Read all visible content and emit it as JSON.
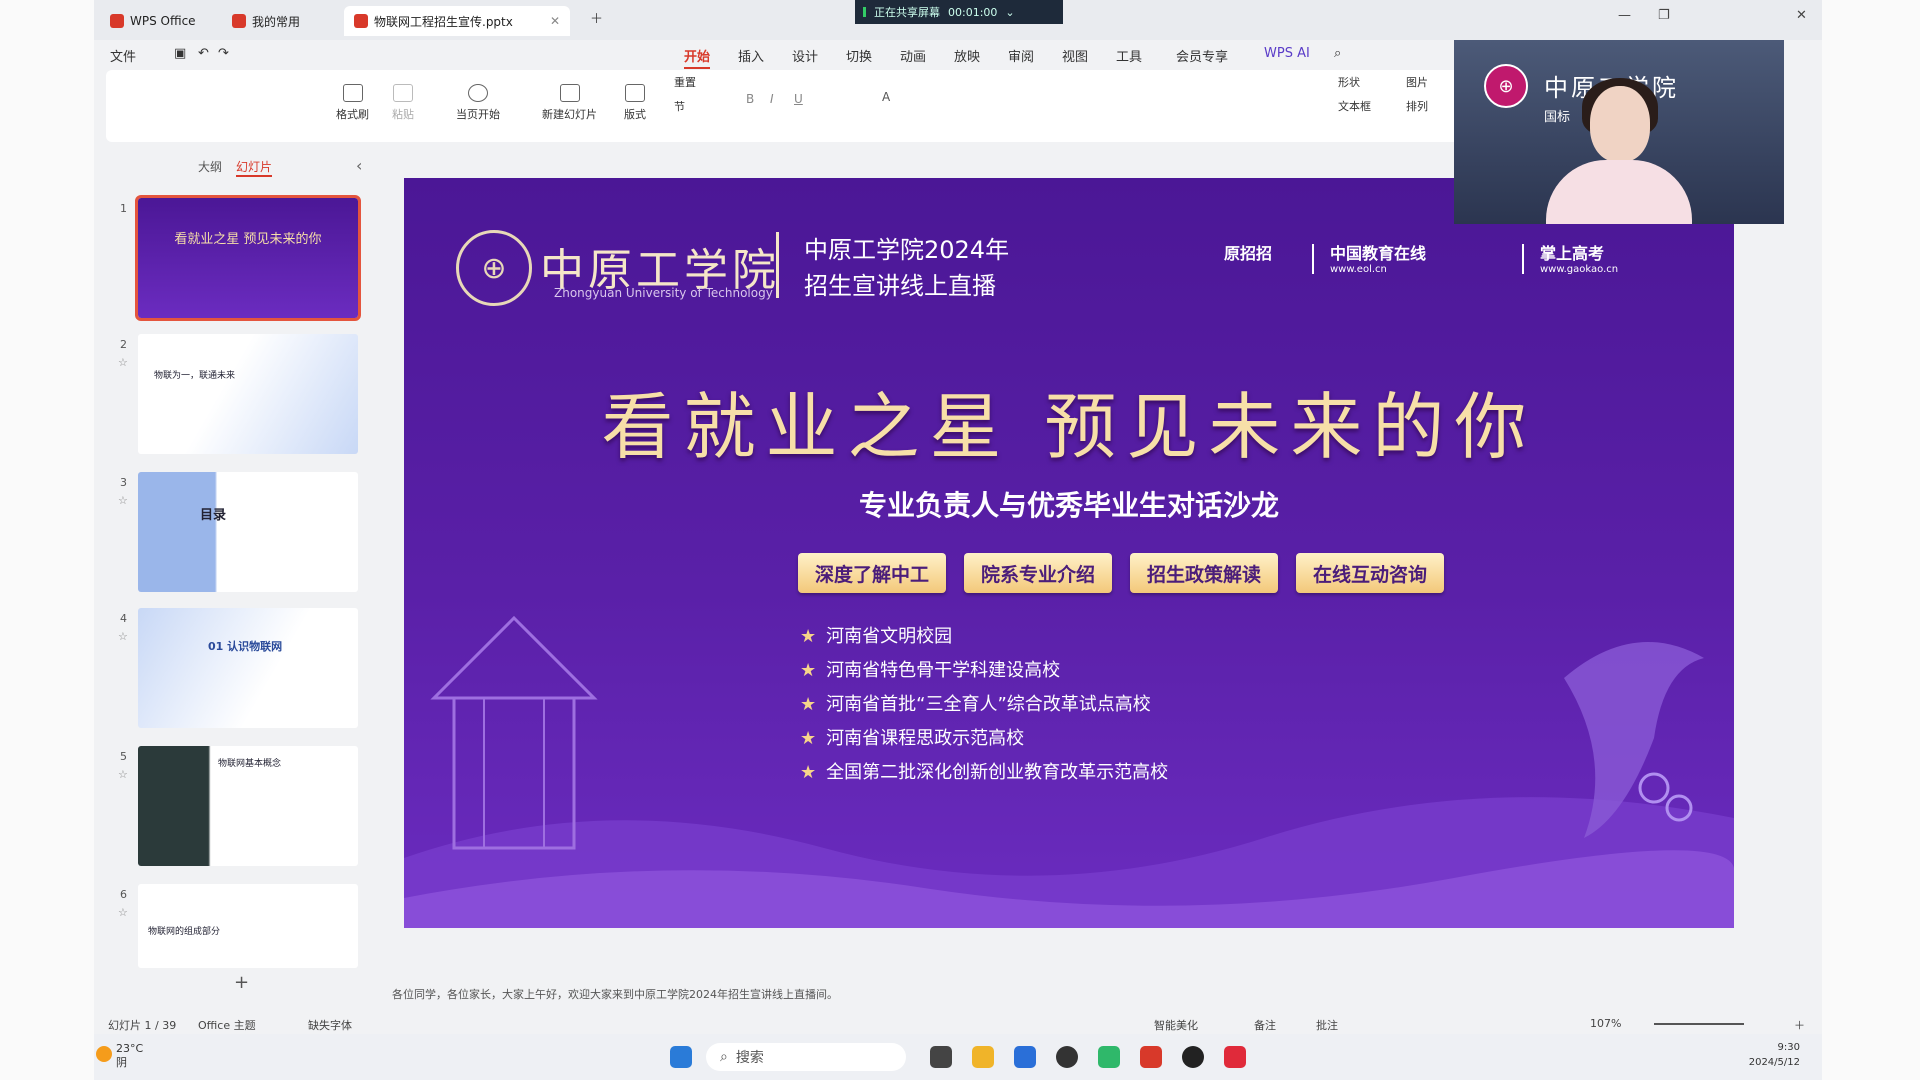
{
  "colors": {
    "accent": "#d8392a",
    "slide_bg": "#5a20a8",
    "title_gold": "#f7dfa8",
    "button_gold": "#f3c87a"
  },
  "tabs": [
    {
      "label": "WPS Office",
      "icon": "wps-icon"
    },
    {
      "label": "我的常用",
      "icon": "doc-icon"
    },
    {
      "label": "物联网工程招生宣传.pptx",
      "icon": "ppt-icon",
      "active": true
    }
  ],
  "recording": {
    "label": "正在共享屏幕",
    "time": "00:01:00"
  },
  "quick": {
    "file_label": "文件"
  },
  "menu": [
    "开始",
    "插入",
    "设计",
    "切换",
    "动画",
    "放映",
    "审阅",
    "视图",
    "工具",
    "会员专享"
  ],
  "wps_ai": "WPS AI",
  "ribbon": {
    "format_painter": "格式刷",
    "paste": "粘贴",
    "from_current": "当页开始",
    "new_slide": "新建幻灯片",
    "layout": "版式",
    "reset": "重置",
    "section": "节",
    "shape": "形状",
    "picture": "图片",
    "textbox": "文本框",
    "arrange": "排列"
  },
  "sidebar": {
    "tab_outline": "大纲",
    "tab_slides": "幻灯片",
    "thumbs": [
      {
        "num": "1",
        "caption": "看就业之星  预见未来的你"
      },
      {
        "num": "2",
        "caption": "物联为一，联通未来"
      },
      {
        "num": "3",
        "caption": "目录"
      },
      {
        "num": "4",
        "caption": "01  认识物联网"
      },
      {
        "num": "5",
        "caption": "物联网基本概念"
      },
      {
        "num": "6",
        "caption": "物联网的组成部分"
      }
    ],
    "add": "+"
  },
  "slide": {
    "school_cn": "中原工学院",
    "school_en": "Zhongyuan University of Technology",
    "event_line1": "中原工学院2024年",
    "event_line2": "招生宣讲线上直播",
    "partner1": "原招招",
    "partner2": "中国教育在线",
    "partner2_url": "www.eol.cn",
    "partner3": "掌上高考",
    "partner3_url": "www.gaokao.cn",
    "title": "看就业之星  预见未来的你",
    "subtitle": "专业负责人与优秀毕业生对话沙龙",
    "buttons": [
      "深度了解中工",
      "院系专业介绍",
      "招生政策解读",
      "在线互动咨询"
    ],
    "honors": [
      "河南省文明校园",
      "河南省特色骨干学科建设高校",
      "河南省首批“三全育人”综合改革试点高校",
      "河南省课程思政示范高校",
      "全国第二批深化创新创业教育改革示范高校"
    ]
  },
  "notes": "各位同学，各位家长，大家上午好，欢迎大家来到中原工学院2024年招生宣讲线上直播间。",
  "status": {
    "slide_count": "幻灯片 1 / 39",
    "theme": "Office 主题",
    "missing_font": "缺失字体",
    "beautify": "智能美化",
    "notes_btn": "备注",
    "comments_btn": "批注",
    "zoom": "107%"
  },
  "webcam": {
    "school": "中原工学院",
    "tag": "国标"
  },
  "taskbar": {
    "weather_temp": "23°C",
    "weather_text": "阴",
    "search_placeholder": "搜索",
    "time": "9:30",
    "date": "2024/5/12"
  }
}
